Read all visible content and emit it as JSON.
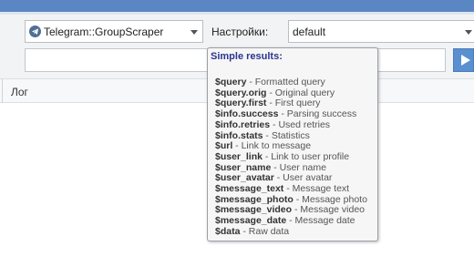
{
  "scraper": {
    "selected": "Telegram::GroupScraper",
    "icon": "telegram-icon"
  },
  "settings": {
    "label": "Настройки:",
    "selected": "default"
  },
  "query": {
    "value": ""
  },
  "log": {
    "label": "Лог"
  },
  "tooltip": {
    "title": "Simple results:",
    "items": [
      {
        "var": "$query",
        "desc": " - Formatted query"
      },
      {
        "var": "$query.orig",
        "desc": " - Original query"
      },
      {
        "var": "$query.first",
        "desc": " - First query"
      },
      {
        "var": "$info.success",
        "desc": " - Parsing success"
      },
      {
        "var": "$info.retries",
        "desc": " - Used retries"
      },
      {
        "var": "$info.stats",
        "desc": " - Statistics"
      },
      {
        "var": "$url",
        "desc": " - Link to message"
      },
      {
        "var": "$user_link",
        "desc": " - Link to user profile"
      },
      {
        "var": "$user_name",
        "desc": " - User name"
      },
      {
        "var": "$user_avatar",
        "desc": " - User avatar"
      },
      {
        "var": "$message_text",
        "desc": " - Message text"
      },
      {
        "var": "$message_photo",
        "desc": " - Message photo"
      },
      {
        "var": "$message_video",
        "desc": " - Message video"
      },
      {
        "var": "$message_date",
        "desc": " - Message date"
      },
      {
        "var": "$data",
        "desc": " - Raw data"
      }
    ]
  },
  "colors": {
    "accent": "#5b86c4",
    "tooltip_title": "#2a3590",
    "run_button": "#5a8fd0"
  }
}
